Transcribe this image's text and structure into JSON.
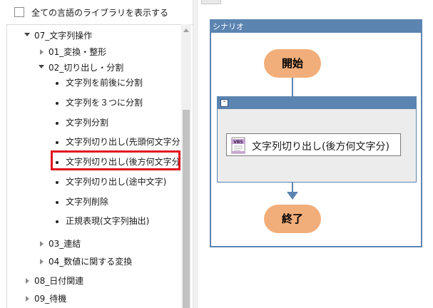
{
  "left_panel": {
    "show_all_label": "全ての言語のライブラリを表示する",
    "tree": {
      "items": [
        {
          "label": "07_文字列操作",
          "kind": "folder-open"
        },
        {
          "label": "01_変換・整形",
          "kind": "folder-closed"
        },
        {
          "label": "02_切り出し・分割",
          "kind": "folder-open"
        },
        {
          "label": "文字列を前後に分割",
          "kind": "leaf"
        },
        {
          "label": "文字列を３つに分割",
          "kind": "leaf"
        },
        {
          "label": "文字列分割",
          "kind": "leaf"
        },
        {
          "label": "文字列切り出し(先頭何文字分)",
          "kind": "leaf"
        },
        {
          "label": "文字列切り出し(後方何文字分)",
          "kind": "leaf",
          "selected": true
        },
        {
          "label": "文字列切り出し(途中文字)",
          "kind": "leaf"
        },
        {
          "label": "文字列削除",
          "kind": "leaf"
        },
        {
          "label": "正規表現(文字列抽出)",
          "kind": "leaf"
        },
        {
          "label": "03_連結",
          "kind": "folder-closed"
        },
        {
          "label": "04_数値に関する変換",
          "kind": "folder-closed"
        },
        {
          "label": "08_日付関連",
          "kind": "folder-closed"
        },
        {
          "label": "09_待機",
          "kind": "folder-closed"
        }
      ]
    },
    "highlight_color": "#e0141e"
  },
  "scenario": {
    "title": "シナリオ",
    "start_label": "開始",
    "end_label": "終了",
    "group_collapse_glyph": "-",
    "action": {
      "icon": "vbs-script-icon",
      "icon_text": "VBS",
      "label": "文字列切り出し(後方何文字分)"
    },
    "colors": {
      "frame": "#5b84b1",
      "terminal": "#f2ae7a",
      "group_bg": "#ececec"
    }
  }
}
